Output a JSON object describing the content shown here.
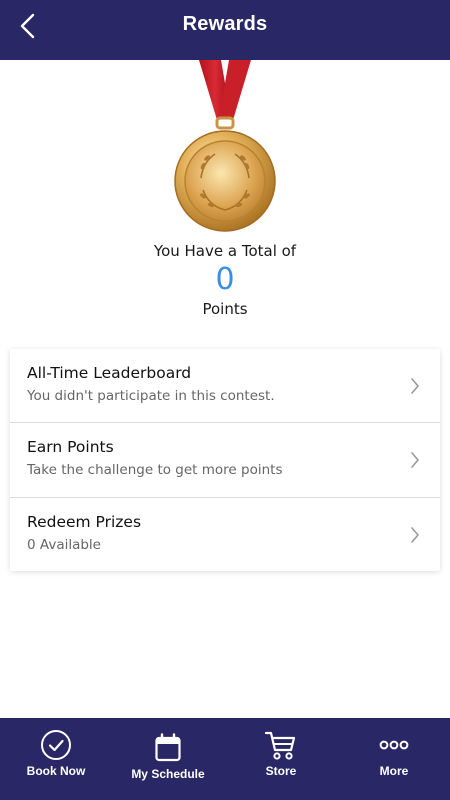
{
  "header": {
    "title": "Rewards",
    "back_icon": "chevron-left-icon"
  },
  "summary": {
    "total_label": "You Have a Total of",
    "points": "0",
    "points_unit": "Points",
    "medal_icon": "gold-medal-icon"
  },
  "menu": {
    "items": [
      {
        "title": "All-Time Leaderboard",
        "subtitle": "You didn't participate in this contest."
      },
      {
        "title": "Earn Points",
        "subtitle": "Take the challenge to get more points"
      },
      {
        "title": "Redeem Prizes",
        "subtitle": "0 Available"
      }
    ]
  },
  "tabbar": {
    "tabs": [
      {
        "label": "Book Now",
        "icon": "check-circle-icon"
      },
      {
        "label": "My Schedule",
        "icon": "calendar-icon"
      },
      {
        "label": "Store",
        "icon": "cart-icon"
      },
      {
        "label": "More",
        "icon": "more-dots-icon"
      }
    ]
  },
  "colors": {
    "brand_navy": "#2a2766",
    "points_blue": "#3a8ee6",
    "ribbon_red": "#c8202b",
    "medal_gold": "#d9a447"
  }
}
